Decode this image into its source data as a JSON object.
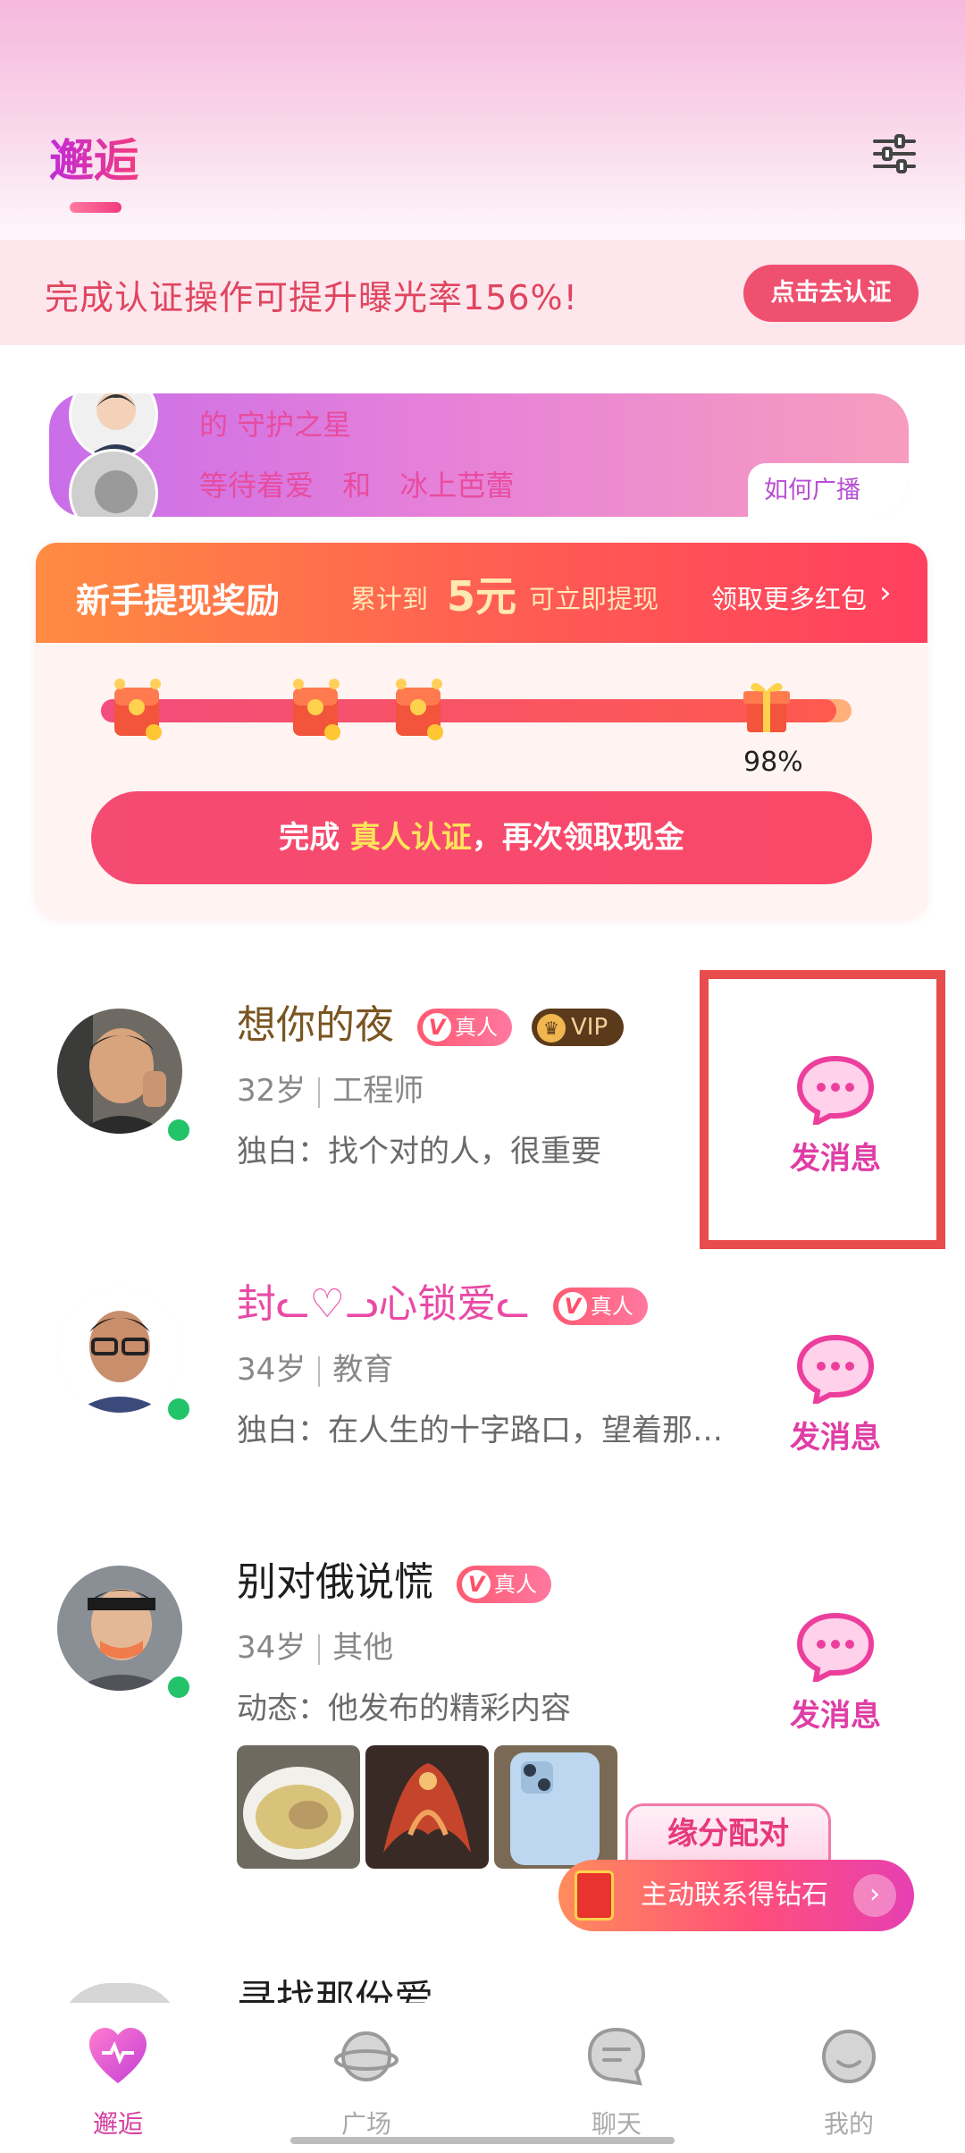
{
  "header": {
    "active_tab": "邂逅",
    "filter_icon": "sliders-icon"
  },
  "cert_banner": {
    "text": "完成认证操作可提升曝光率156%!",
    "button": "点击去认证"
  },
  "broadcast": {
    "row1": "的 守护之星",
    "row2_a": "等待着爱",
    "row2_and": "和",
    "row2_b": "冰上芭蕾",
    "how_link": "如何广播"
  },
  "reward": {
    "title": "新手提现奖励",
    "pre": "累计到",
    "amount": "5元",
    "post": "可立即提现",
    "more": "领取更多红包",
    "progress_percent": 98,
    "progress_label": "98%",
    "btn_pre": "完成 ",
    "btn_highlight": "真人认证",
    "btn_post": "，再次领取现金"
  },
  "users": [
    {
      "name": "想你的夜",
      "badge_real": "真人",
      "badge_vip": "VIP",
      "age": "32岁",
      "job": "工程师",
      "bio": "独白：找个对的人，很重要",
      "msg": "发消息"
    },
    {
      "name": "封ᓚ♡ᓗ心锁爱ᓚ",
      "badge_real": "真人",
      "age": "34岁",
      "job": "教育",
      "bio": "独白：在人生的十字路口，望着那…",
      "msg": "发消息"
    },
    {
      "name": "别对俄说慌",
      "badge_real": "真人",
      "age": "34岁",
      "job": "其他",
      "bio": "动态：他发布的精彩内容",
      "msg": "发消息"
    },
    {
      "name": "寻找那份爱"
    }
  ],
  "promo": {
    "fate": "缘分配对",
    "contact": "主动联系得钻石"
  },
  "nav": [
    {
      "label": "邂逅",
      "icon": "heart-icon"
    },
    {
      "label": "广场",
      "icon": "planet-icon"
    },
    {
      "label": "聊天",
      "icon": "chat-icon"
    },
    {
      "label": "我的",
      "icon": "profile-icon"
    }
  ],
  "colors": {
    "accent": "#e03da6",
    "brand_red": "#f0506f",
    "online": "#23c36a"
  }
}
